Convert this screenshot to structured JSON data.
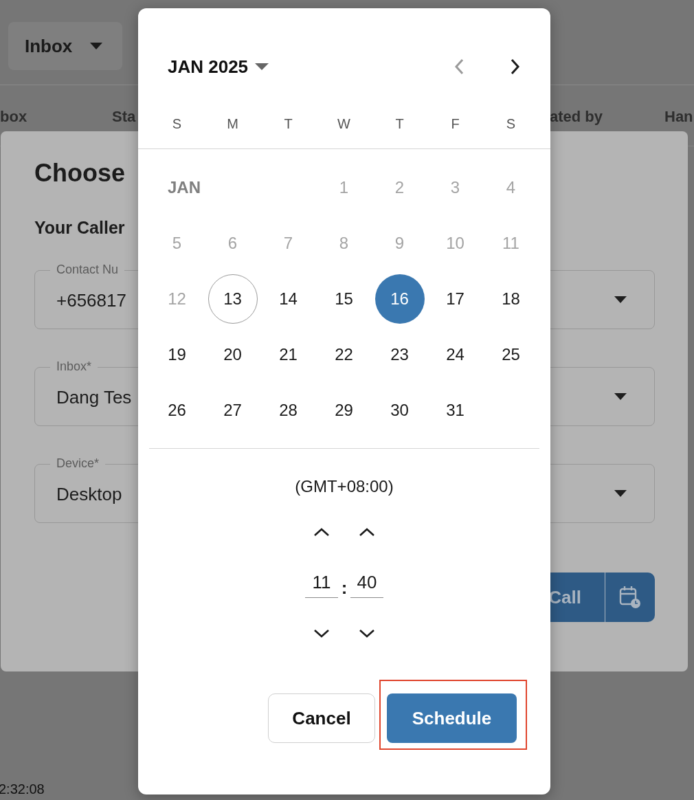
{
  "background": {
    "inbox_button": "Inbox",
    "table_headers": [
      "box",
      "Sta",
      "ated by",
      "Han"
    ],
    "time": "2:32:08"
  },
  "dialog": {
    "title": "Choose",
    "subtitle": "Your Caller",
    "fields": [
      {
        "label": "Contact Nu",
        "value": "+656817"
      },
      {
        "label": "Inbox*",
        "value": "Dang Tes"
      },
      {
        "label": "Device*",
        "value": "Desktop"
      }
    ],
    "call_button": "Call"
  },
  "picker": {
    "month_title": "JAN 2025",
    "prev_disabled": true,
    "weekdays": [
      "S",
      "M",
      "T",
      "W",
      "T",
      "F",
      "S"
    ],
    "month_label": "JAN",
    "days": [
      {
        "label": "1",
        "disabled": true,
        "today": false,
        "selected": false
      },
      {
        "label": "2",
        "disabled": true,
        "today": false,
        "selected": false
      },
      {
        "label": "3",
        "disabled": true,
        "today": false,
        "selected": false
      },
      {
        "label": "4",
        "disabled": true,
        "today": false,
        "selected": false
      },
      {
        "label": "5",
        "disabled": true,
        "today": false,
        "selected": false
      },
      {
        "label": "6",
        "disabled": true,
        "today": false,
        "selected": false
      },
      {
        "label": "7",
        "disabled": true,
        "today": false,
        "selected": false
      },
      {
        "label": "8",
        "disabled": true,
        "today": false,
        "selected": false
      },
      {
        "label": "9",
        "disabled": true,
        "today": false,
        "selected": false
      },
      {
        "label": "10",
        "disabled": true,
        "today": false,
        "selected": false
      },
      {
        "label": "11",
        "disabled": true,
        "today": false,
        "selected": false
      },
      {
        "label": "12",
        "disabled": true,
        "today": false,
        "selected": false
      },
      {
        "label": "13",
        "disabled": false,
        "today": true,
        "selected": false
      },
      {
        "label": "14",
        "disabled": false,
        "today": false,
        "selected": false
      },
      {
        "label": "15",
        "disabled": false,
        "today": false,
        "selected": false
      },
      {
        "label": "16",
        "disabled": false,
        "today": false,
        "selected": true
      },
      {
        "label": "17",
        "disabled": false,
        "today": false,
        "selected": false
      },
      {
        "label": "18",
        "disabled": false,
        "today": false,
        "selected": false
      },
      {
        "label": "19",
        "disabled": false,
        "today": false,
        "selected": false
      },
      {
        "label": "20",
        "disabled": false,
        "today": false,
        "selected": false
      },
      {
        "label": "21",
        "disabled": false,
        "today": false,
        "selected": false
      },
      {
        "label": "22",
        "disabled": false,
        "today": false,
        "selected": false
      },
      {
        "label": "23",
        "disabled": false,
        "today": false,
        "selected": false
      },
      {
        "label": "24",
        "disabled": false,
        "today": false,
        "selected": false
      },
      {
        "label": "25",
        "disabled": false,
        "today": false,
        "selected": false
      },
      {
        "label": "26",
        "disabled": false,
        "today": false,
        "selected": false
      },
      {
        "label": "27",
        "disabled": false,
        "today": false,
        "selected": false
      },
      {
        "label": "28",
        "disabled": false,
        "today": false,
        "selected": false
      },
      {
        "label": "29",
        "disabled": false,
        "today": false,
        "selected": false
      },
      {
        "label": "30",
        "disabled": false,
        "today": false,
        "selected": false
      },
      {
        "label": "31",
        "disabled": false,
        "today": false,
        "selected": false
      }
    ],
    "timezone": "(GMT+08:00)",
    "hour": "11",
    "separator": ":",
    "minute": "40",
    "cancel_button": "Cancel",
    "schedule_button": "Schedule",
    "schedule_highlighted": true
  }
}
